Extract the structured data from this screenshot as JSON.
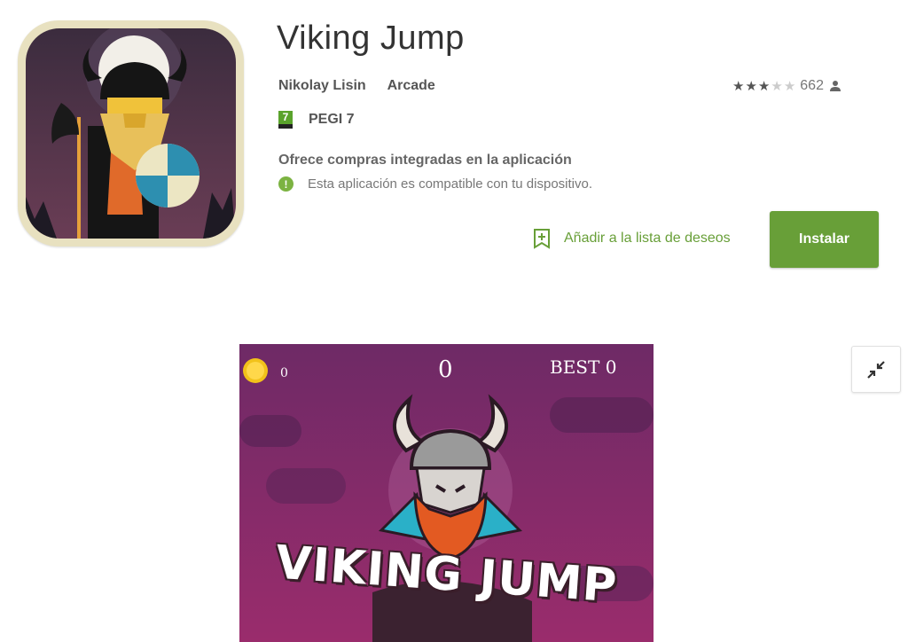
{
  "app": {
    "title": "Viking Jump",
    "developer": "Nikolay Lisin",
    "category": "Arcade",
    "rating_count": "662",
    "rating_value": 2.5,
    "pegi_number": "7",
    "pegi_label": "PEGI 7",
    "in_app_purchases": "Ofrece compras integradas en la aplicación",
    "compatibility": "Esta aplicación es compatible con tu dispositivo.",
    "compat_icon_glyph": "!"
  },
  "actions": {
    "wishlist_label": "Añadir a la lista de deseos",
    "install_label": "Instalar"
  },
  "screenshot": {
    "coins": "0",
    "score": "0",
    "best": "BEST  0",
    "game_title": "VIKING JUMP"
  },
  "icons": {
    "wishlist": "bookmark-add-icon",
    "collapse": "collapse-icon",
    "user": "person-icon",
    "compat": "info-icon"
  },
  "colors": {
    "accent": "#689f38",
    "screenshot_bg": "#8a2a6a"
  }
}
